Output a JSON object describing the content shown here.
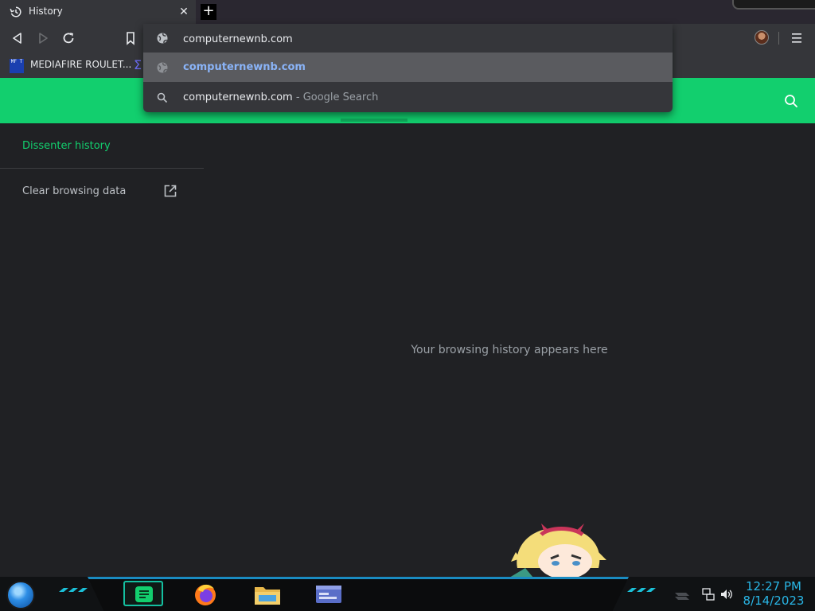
{
  "tab": {
    "title": "History",
    "close_glyph": "✕",
    "new_tab_glyph": "+"
  },
  "toolbar": {
    "back_icon": "back-arrow-icon",
    "forward_icon": "forward-arrow-icon",
    "reload_icon": "reload-icon",
    "bookmark_icon": "bookmark-icon",
    "menu_icon": "hamburger-menu-icon"
  },
  "omnibox": {
    "input_value": "computernewnb.com",
    "suggestions": [
      {
        "text": "computernewnb.com",
        "suffix": "",
        "icon": "globe-icon"
      },
      {
        "text": "computernewnb.com",
        "suffix": " - Google Search",
        "icon": "search-icon"
      }
    ]
  },
  "bookmarks": {
    "items": [
      {
        "label": "MEDIAFIRE ROULET...",
        "icon_text": "MF T"
      }
    ]
  },
  "sidebar": {
    "history_label": "Dissenter history",
    "clear_label": "Clear browsing data"
  },
  "main": {
    "empty_message": "Your browsing history appears here"
  },
  "taskbar": {
    "clock_time": "12:27 PM",
    "clock_date": "8/14/2023"
  },
  "colors": {
    "accent_green": "#12cf6e",
    "suggestion_blue": "#8ab4f8",
    "clock_blue": "#29b6e6",
    "page_bg": "#202124"
  }
}
